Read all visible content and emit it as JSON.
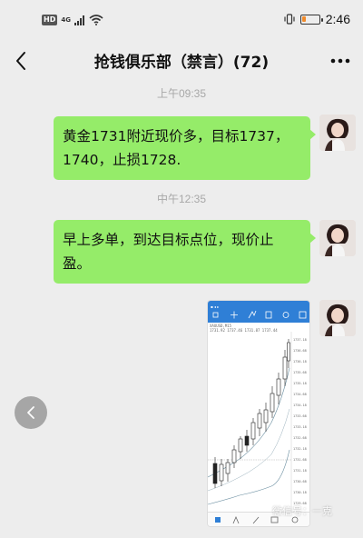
{
  "status_bar": {
    "hd": "HD",
    "network": "4G",
    "time": "2:46",
    "battery_level": 0.2,
    "battery_color": "#f08a2a"
  },
  "nav": {
    "title": "抢钱俱乐部（禁言）(72)",
    "back_icon": "chevron-left-icon",
    "more_icon": "more-dots-icon"
  },
  "messages": [
    {
      "timestamp": "上午09:35",
      "text": "黄金1731附近现价多，目标1737，1740，止损1728."
    },
    {
      "timestamp": "中午12:35",
      "text": "早上多单，到达目标点位，现价止盈。"
    }
  ],
  "image_message": {
    "symbol": "XAUUSD,M15",
    "quote": "1731.92 1737.46 1731.87 1737.44",
    "watermark": "微信号：一克"
  },
  "colors": {
    "bubble": "#95ec69",
    "background": "#ededed",
    "chart_header": "#2f7fd6"
  }
}
